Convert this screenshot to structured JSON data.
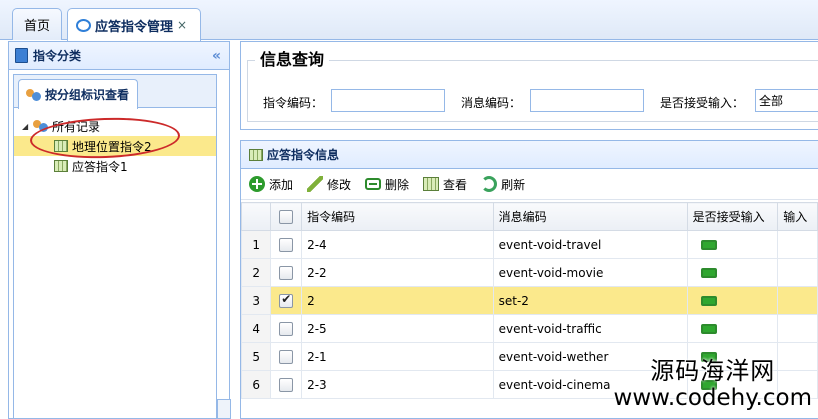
{
  "tabs": [
    {
      "label": "首页"
    },
    {
      "label": "应答指令管理",
      "close": "×"
    }
  ],
  "left_panel": {
    "title": "指令分类",
    "collapse_glyph": "«",
    "subtab_label": "按分组标识查看",
    "tree": {
      "root_label": "所有记录",
      "children": [
        {
          "label": "地理位置指令2",
          "selected": true
        },
        {
          "label": "应答指令1",
          "selected": false
        }
      ]
    }
  },
  "query": {
    "title": "信息查询",
    "fields": [
      {
        "label": "指令编码：",
        "value": ""
      },
      {
        "label": "消息编码：",
        "value": ""
      },
      {
        "label": "是否接受输入：",
        "value": "全部"
      }
    ]
  },
  "grid_panel": {
    "title": "应答指令信息",
    "toolbar": {
      "add": "添加",
      "edit": "修改",
      "delete": "删除",
      "view": "查看",
      "refresh": "刷新"
    },
    "columns": [
      "指令编码",
      "消息编码",
      "是否接受输入",
      "输入"
    ],
    "rows": [
      {
        "num": "1",
        "code": "2-4",
        "msg": "event-void-travel",
        "checked": false
      },
      {
        "num": "2",
        "code": "2-2",
        "msg": "event-void-movie",
        "checked": false
      },
      {
        "num": "3",
        "code": "2",
        "msg": "set-2",
        "checked": true
      },
      {
        "num": "4",
        "code": "2-5",
        "msg": "event-void-traffic",
        "checked": false
      },
      {
        "num": "5",
        "code": "2-1",
        "msg": "event-void-wether",
        "checked": false
      },
      {
        "num": "6",
        "code": "2-3",
        "msg": "event-void-cinema",
        "checked": false
      }
    ]
  },
  "watermark": {
    "line1": "源码海洋网",
    "line2": "www.codehy.com"
  }
}
